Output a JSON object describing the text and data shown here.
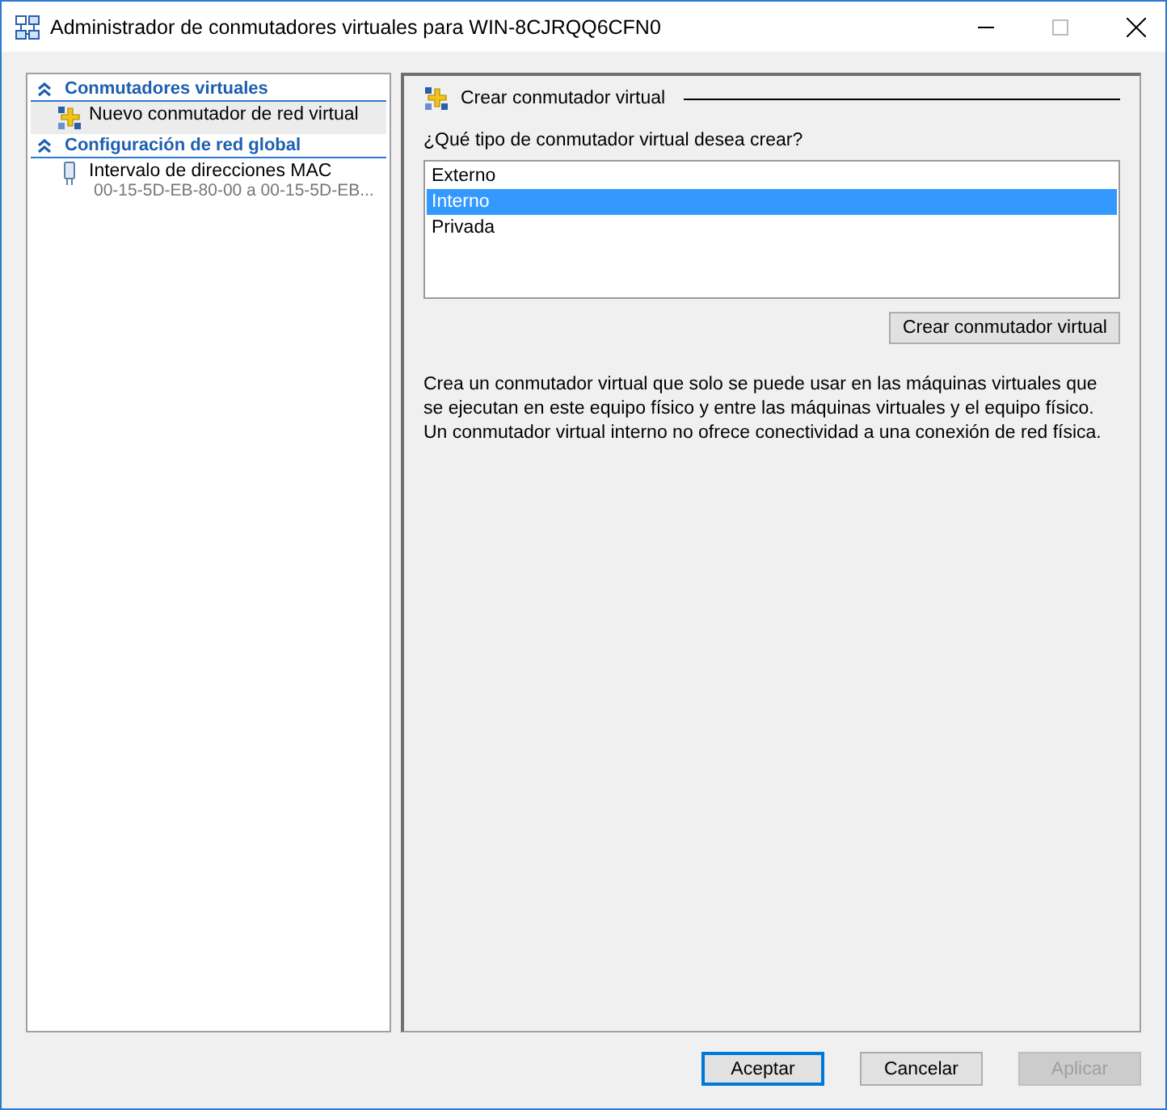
{
  "window": {
    "title": "Administrador de conmutadores virtuales para WIN-8CJRQQ6CFN0"
  },
  "sidebar": {
    "sections": [
      {
        "title": "Conmutadores virtuales",
        "expanded": true,
        "items": [
          {
            "kind": "switch",
            "label": "Nuevo conmutador de red virtual",
            "selected": true
          }
        ]
      },
      {
        "title": "Configuración de red global",
        "expanded": true,
        "items": [
          {
            "kind": "mac",
            "label": "Intervalo de direcciones MAC",
            "detail": "00-15-5D-EB-80-00 a 00-15-5D-EB...",
            "selected": false
          }
        ]
      }
    ]
  },
  "panel": {
    "title": "Crear conmutador virtual",
    "question": "¿Qué tipo de conmutador virtual desea crear?",
    "options": [
      {
        "label": "Externo",
        "selected": false
      },
      {
        "label": "Interno",
        "selected": true
      },
      {
        "label": "Privada",
        "selected": false
      }
    ],
    "create_button": "Crear conmutador virtual",
    "description": "Crea un conmutador virtual que solo se puede usar en las máquinas virtuales que se ejecutan en este equipo físico y entre las máquinas virtuales y el equipo físico. Un conmutador virtual interno no ofrece conectividad a una conexión de red física."
  },
  "buttons": [
    {
      "label": "Aceptar",
      "default": true,
      "disabled": false
    },
    {
      "label": "Cancelar",
      "default": false,
      "disabled": false
    },
    {
      "label": "Aplicar",
      "default": false,
      "disabled": true
    }
  ]
}
